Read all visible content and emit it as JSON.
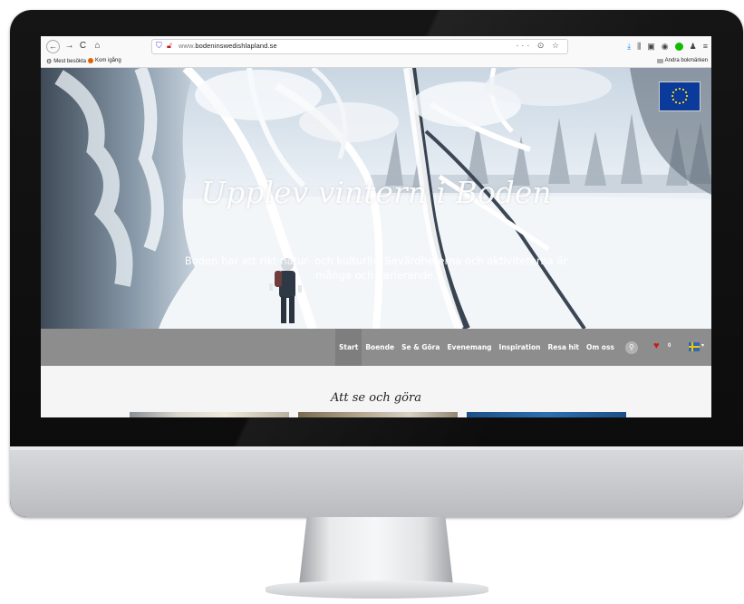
{
  "browser": {
    "url_domain": "www.",
    "url_host": "bodeninswedishlapland.se",
    "url_actions": "··· ⊙ ☆",
    "bookmarks": [
      {
        "label": "Mest besökta"
      },
      {
        "label": "Kom igång"
      }
    ],
    "other_bookmarks": "Andra bokmärken"
  },
  "hero": {
    "title": "Upplev vintern i Boden",
    "subtitle": "Boden har ett rikt natur- och kulturliv. Sevärdheterna och aktiviteterna är många och varierande."
  },
  "nav": {
    "items": [
      "Start",
      "Boende",
      "Se & Göra",
      "Evenemang",
      "Inspiration",
      "Resa hit",
      "Om oss"
    ],
    "active": "Start",
    "favorites_count": "0"
  },
  "content": {
    "section_title": "Att se och göra"
  },
  "colors": {
    "nav_bg": "#8e8d8d",
    "nav_active_bg": "#7f7e7e",
    "heart": "#d01818",
    "eu_blue": "#0a3a9a",
    "se_blue": "#2f69b6",
    "se_yellow": "#f4c400"
  }
}
